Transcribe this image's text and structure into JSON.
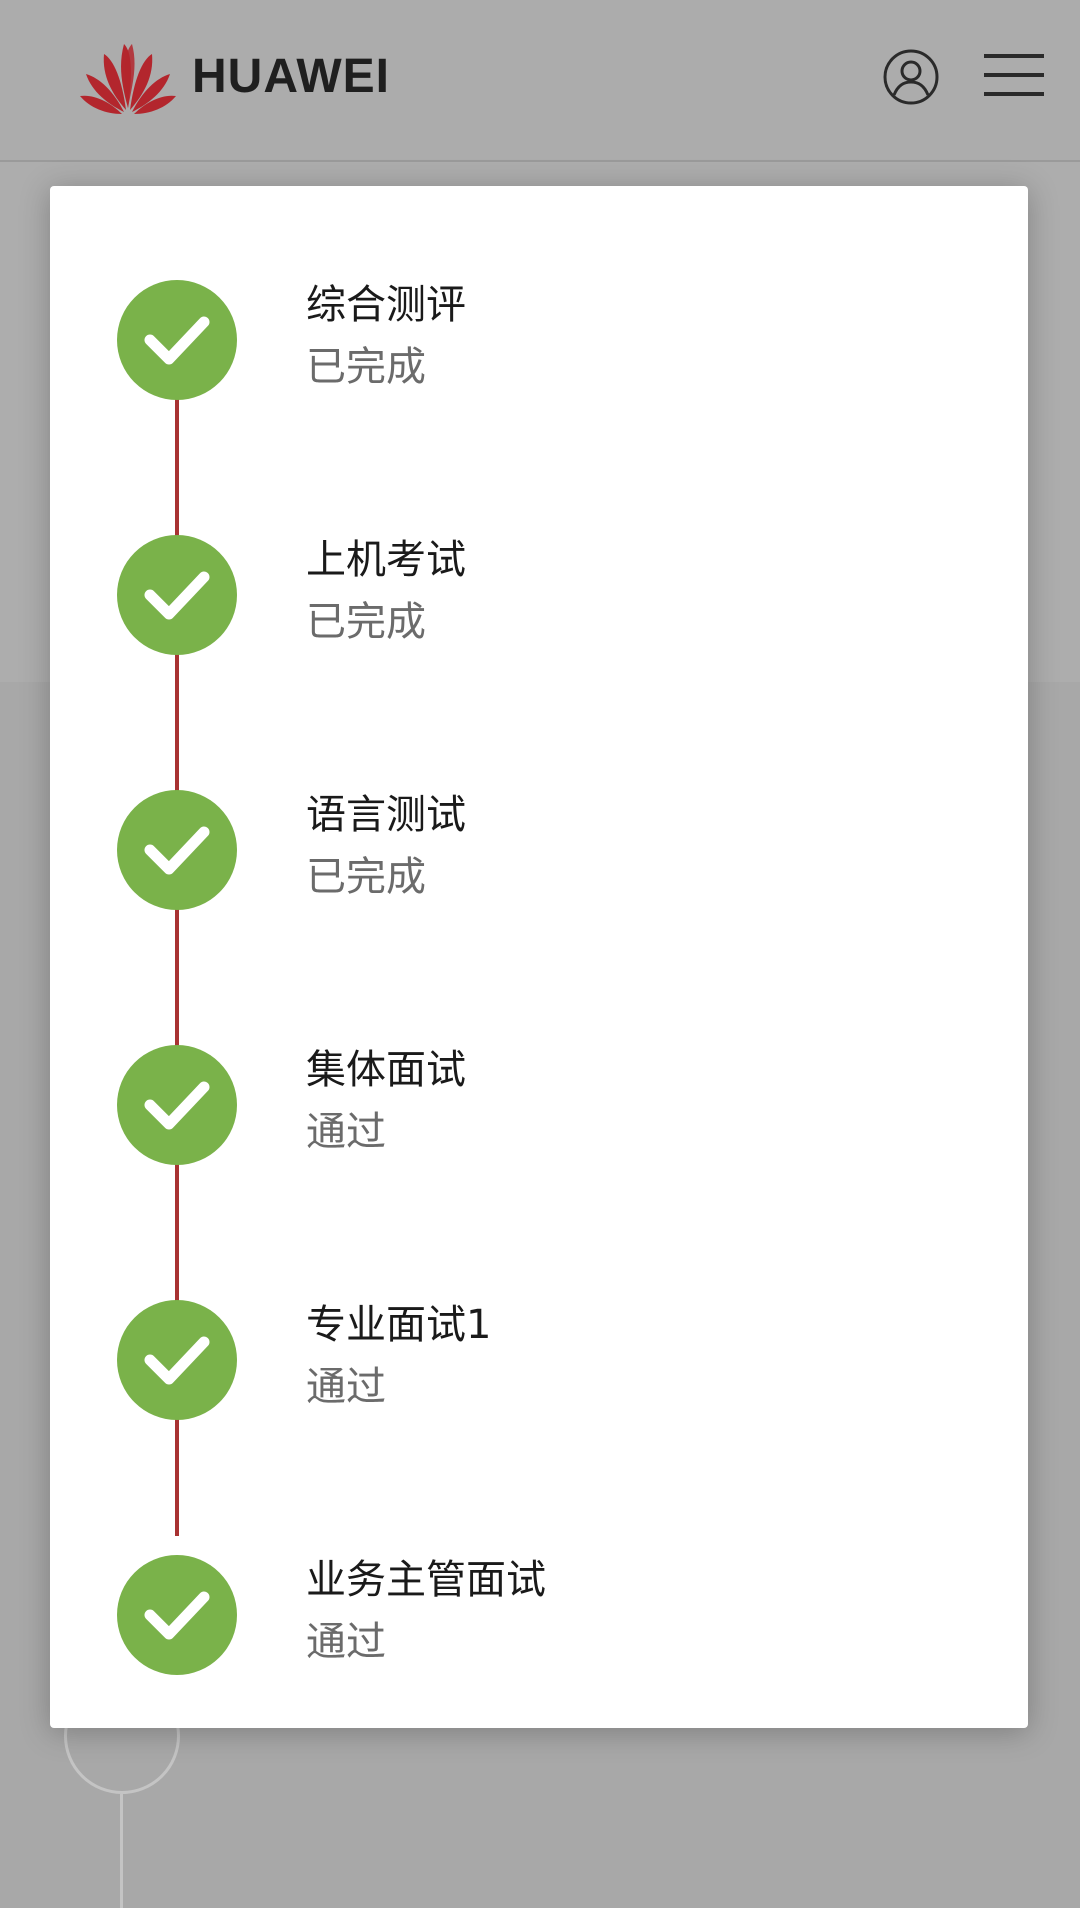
{
  "header": {
    "brand": "HUAWEI",
    "logo_icon": "huawei-petal-logo",
    "user_icon": "user-account-icon",
    "menu_icon": "hamburger-menu-icon",
    "logo_color": "#b3262d"
  },
  "progress": {
    "accent_color": "#7ab24a",
    "line_color": "#a83232",
    "steps": [
      {
        "title": "综合测评",
        "status": "已完成",
        "icon": "check-icon"
      },
      {
        "title": "上机考试",
        "status": "已完成",
        "icon": "check-icon"
      },
      {
        "title": "语言测试",
        "status": "已完成",
        "icon": "check-icon"
      },
      {
        "title": "集体面试",
        "status": "通过",
        "icon": "check-icon"
      },
      {
        "title": "专业面试1",
        "status": "通过",
        "icon": "check-icon"
      },
      {
        "title": "业务主管面试",
        "status": "通过",
        "icon": "check-icon"
      }
    ]
  }
}
